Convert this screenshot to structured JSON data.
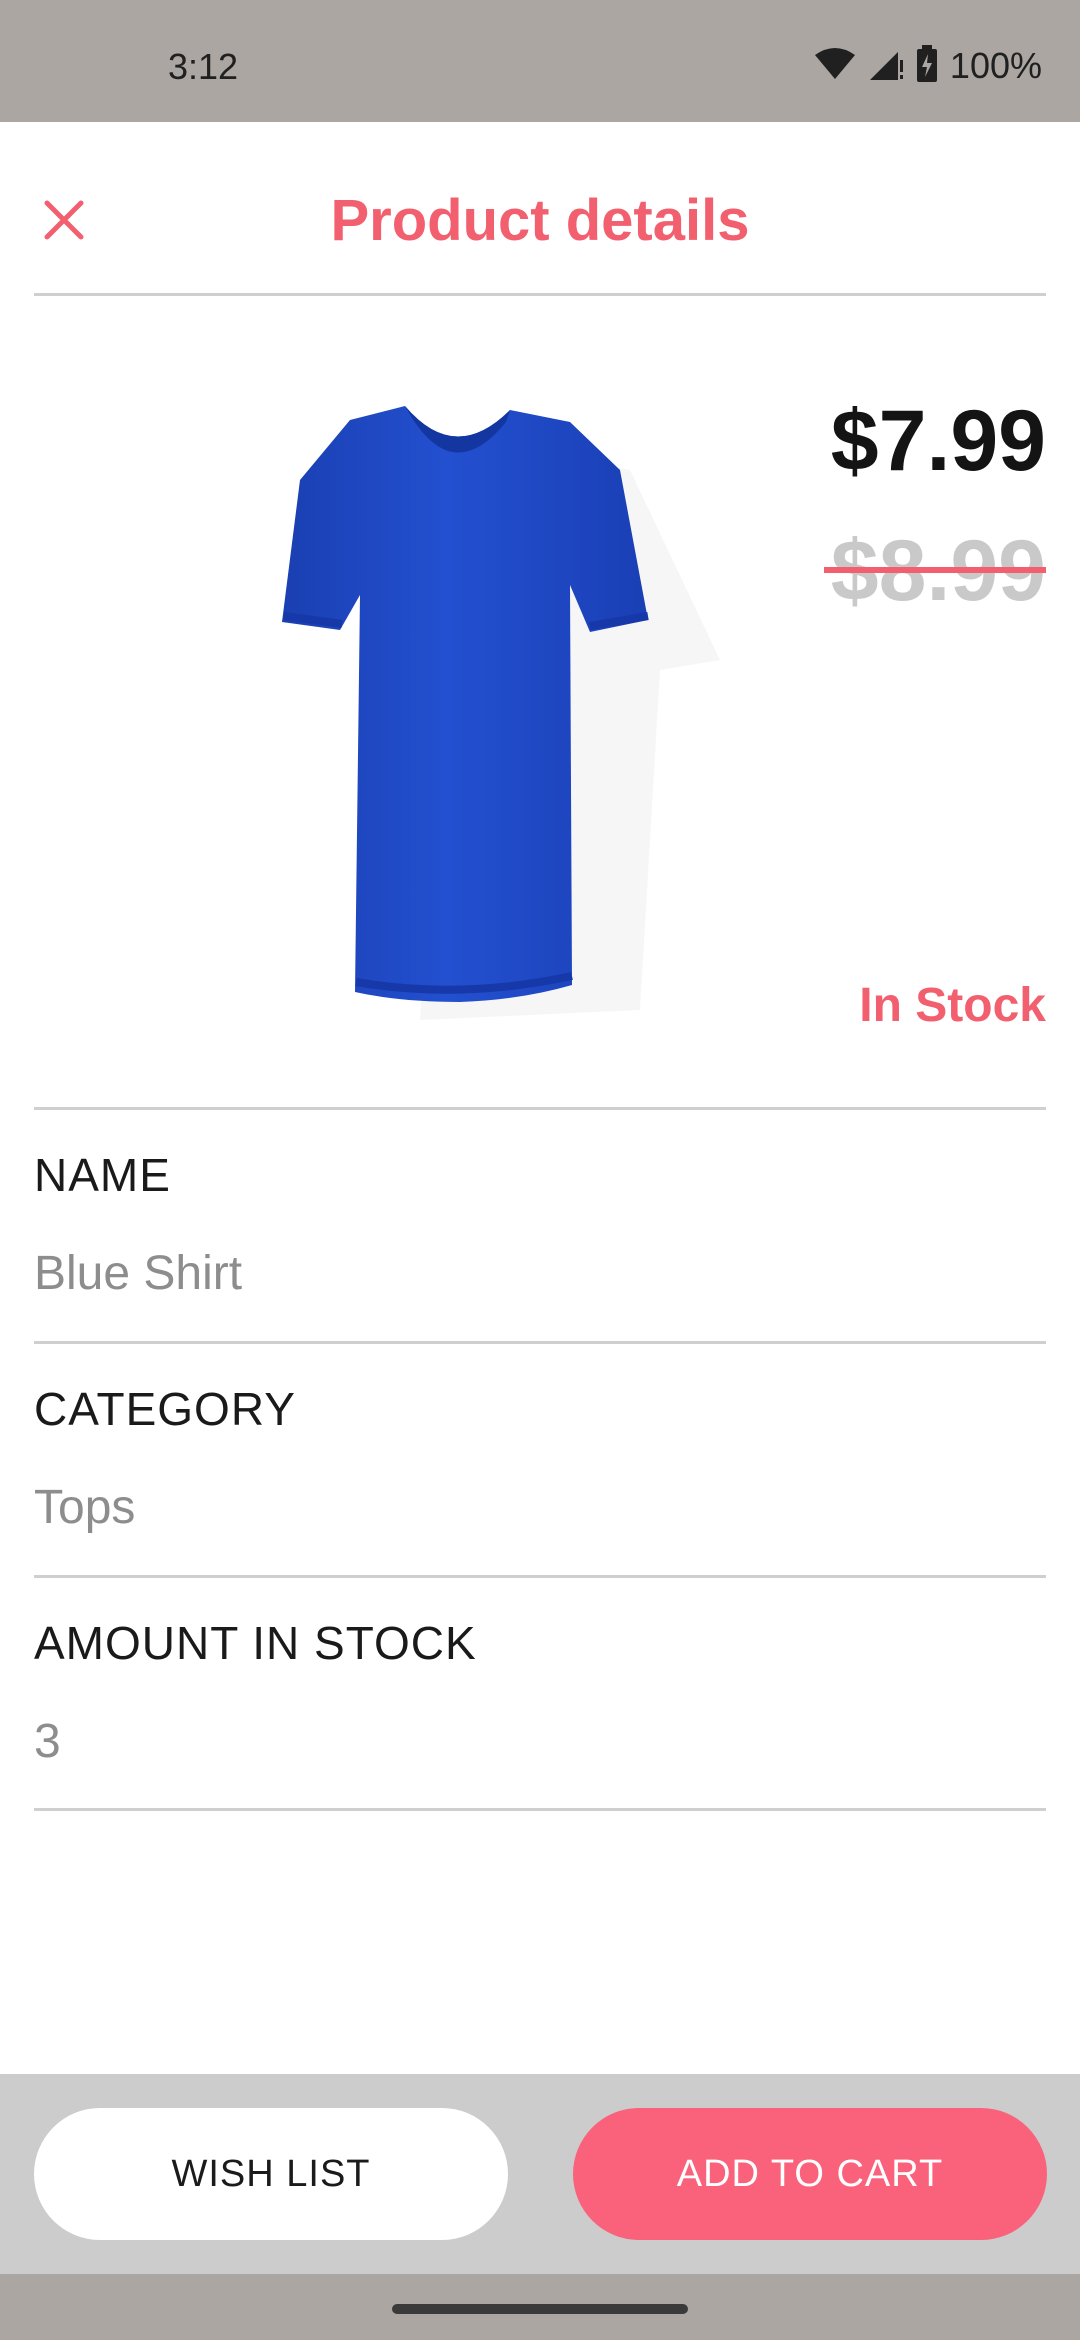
{
  "status_bar": {
    "time": "3:12",
    "battery": "100%",
    "icons": [
      "wifi-icon",
      "signal-icon",
      "battery-charging-icon"
    ]
  },
  "header": {
    "title": "Product details",
    "close_icon": "close-icon"
  },
  "product": {
    "image_icon": "t-shirt-image",
    "image_color": "#1f49c8",
    "price": "$7.99",
    "original_price": "$8.99",
    "stock_status": "In Stock"
  },
  "fields": [
    {
      "label": "NAME",
      "value": "Blue Shirt"
    },
    {
      "label": "CATEGORY",
      "value": "Tops"
    },
    {
      "label": "AMOUNT IN STOCK",
      "value": "3"
    }
  ],
  "actions": {
    "wish_list": "WISH LIST",
    "add_to_cart": "ADD TO CART"
  },
  "colors": {
    "accent": "#f2606f",
    "button_primary": "#f9627a",
    "status_bar": "#aba6a1"
  }
}
